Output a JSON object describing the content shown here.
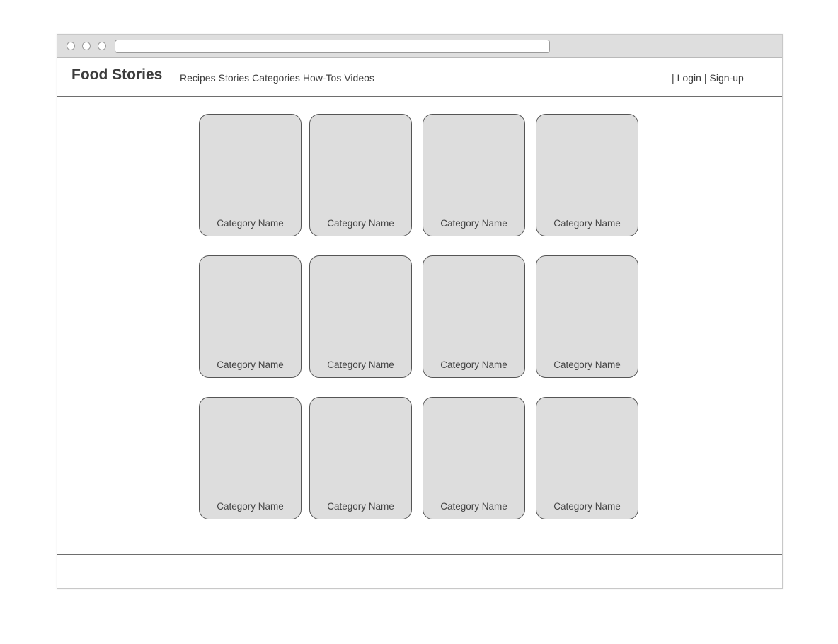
{
  "header": {
    "logo": "Food Stories",
    "nav": [
      "Recipes",
      "Stories",
      "Categories",
      "How-Tos",
      "Videos"
    ],
    "auth": {
      "separator": "|",
      "login": "Login",
      "signup": "Sign-up"
    }
  },
  "categories": [
    "Category Name",
    "Category Name",
    "Category Name",
    "Category Name",
    "Category Name",
    "Category Name",
    "Category Name",
    "Category Name",
    "Category Name",
    "Category Name",
    "Category Name",
    "Category Name"
  ],
  "colors": {
    "card_fill": "#dddddd",
    "card_border": "#555555",
    "titlebar": "#dedede",
    "text": "#3c3c3c"
  }
}
